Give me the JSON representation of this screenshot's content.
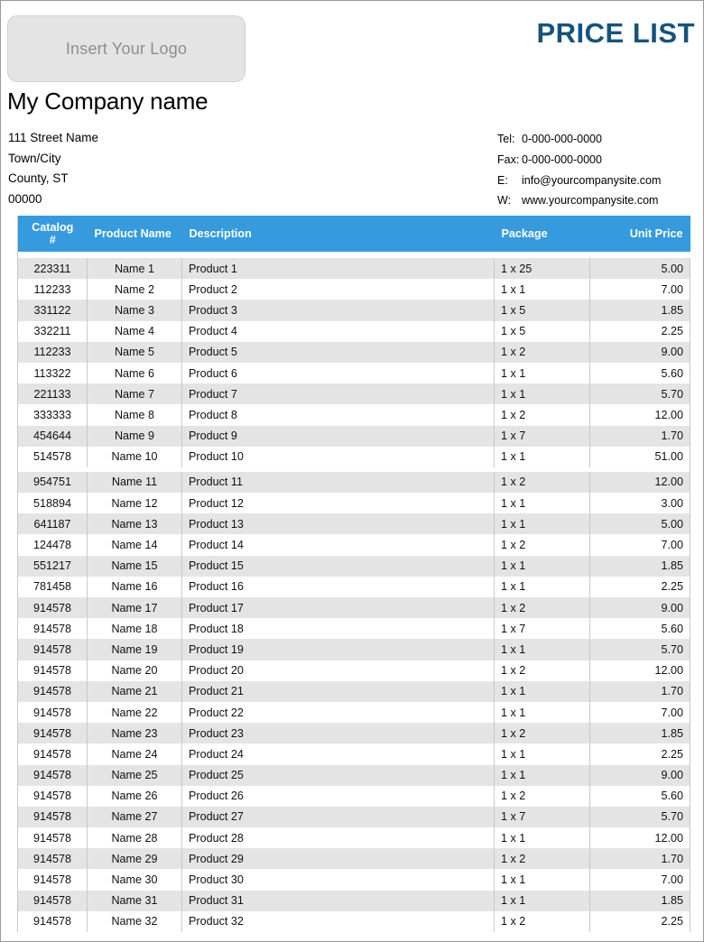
{
  "document": {
    "title": "PRICE LIST",
    "logo_placeholder": "Insert Your Logo",
    "company_name": "My Company name"
  },
  "address": {
    "line1": "111 Street Name",
    "line2": "Town/City",
    "line3": "County, ST",
    "line4": "00000"
  },
  "contact": {
    "tel_label": "Tel:",
    "tel_value": "0-000-000-0000",
    "fax_label": "Fax:",
    "fax_value": "0-000-000-0000",
    "email_label": "E:",
    "email_value": "info@yourcompanysite.com",
    "web_label": "W:",
    "web_value": "www.yourcompanysite.com"
  },
  "colors": {
    "table_header_blue": "#359ade",
    "title_navy": "#15537f",
    "row_shade": "#e4e4e4",
    "logo_fill": "#e4e4e4",
    "border_gray": "#c9c9c9"
  },
  "table": {
    "headers": {
      "catalog_line1": "Catalog",
      "catalog_line2": "#",
      "product_name": "Product Name",
      "description": "Description",
      "package": "Package",
      "unit_price": "Unit Price"
    },
    "rows": [
      {
        "catalog": "223311",
        "name": "Name 1",
        "description": "Product 1",
        "package": "1 x 25",
        "price": "5.00"
      },
      {
        "catalog": "112233",
        "name": "Name 2",
        "description": "Product 2",
        "package": "1 x 1",
        "price": "7.00"
      },
      {
        "catalog": "331122",
        "name": "Name 3",
        "description": "Product 3",
        "package": "1 x 5",
        "price": "1.85"
      },
      {
        "catalog": "332211",
        "name": "Name 4",
        "description": "Product 4",
        "package": "1 x 5",
        "price": "2.25"
      },
      {
        "catalog": "112233",
        "name": "Name 5",
        "description": "Product 5",
        "package": "1 x 2",
        "price": "9.00"
      },
      {
        "catalog": "113322",
        "name": "Name 6",
        "description": "Product 6",
        "package": "1 x 1",
        "price": "5.60"
      },
      {
        "catalog": "221133",
        "name": "Name 7",
        "description": "Product 7",
        "package": "1 x 1",
        "price": "5.70"
      },
      {
        "catalog": "333333",
        "name": "Name 8",
        "description": "Product 8",
        "package": "1 x 2",
        "price": "12.00"
      },
      {
        "catalog": "454644",
        "name": "Name 9",
        "description": "Product 9",
        "package": "1 x 7",
        "price": "1.70"
      },
      {
        "catalog": "514578",
        "name": "Name 10",
        "description": "Product 10",
        "package": "1 x 1",
        "price": "51.00"
      },
      {
        "catalog": "954751",
        "name": "Name 11",
        "description": "Product 11",
        "package": "1 x 2",
        "price": "12.00"
      },
      {
        "catalog": "518894",
        "name": "Name 12",
        "description": "Product 12",
        "package": "1 x 1",
        "price": "3.00"
      },
      {
        "catalog": "641187",
        "name": "Name 13",
        "description": "Product 13",
        "package": "1 x 1",
        "price": "5.00"
      },
      {
        "catalog": "124478",
        "name": "Name 14",
        "description": "Product 14",
        "package": "1 x 2",
        "price": "7.00"
      },
      {
        "catalog": "551217",
        "name": "Name 15",
        "description": "Product 15",
        "package": "1 x 1",
        "price": "1.85"
      },
      {
        "catalog": "781458",
        "name": "Name 16",
        "description": "Product 16",
        "package": "1 x 1",
        "price": "2.25"
      },
      {
        "catalog": "914578",
        "name": "Name 17",
        "description": "Product 17",
        "package": "1 x 2",
        "price": "9.00"
      },
      {
        "catalog": "914578",
        "name": "Name 18",
        "description": "Product 18",
        "package": "1 x 7",
        "price": "5.60"
      },
      {
        "catalog": "914578",
        "name": "Name 19",
        "description": "Product 19",
        "package": "1 x 1",
        "price": "5.70"
      },
      {
        "catalog": "914578",
        "name": "Name 20",
        "description": "Product 20",
        "package": "1 x 2",
        "price": "12.00"
      },
      {
        "catalog": "914578",
        "name": "Name 21",
        "description": "Product 21",
        "package": "1 x 1",
        "price": "1.70"
      },
      {
        "catalog": "914578",
        "name": "Name 22",
        "description": "Product 22",
        "package": "1 x 1",
        "price": "7.00"
      },
      {
        "catalog": "914578",
        "name": "Name 23",
        "description": "Product 23",
        "package": "1 x 2",
        "price": "1.85"
      },
      {
        "catalog": "914578",
        "name": "Name 24",
        "description": "Product 24",
        "package": "1 x 1",
        "price": "2.25"
      },
      {
        "catalog": "914578",
        "name": "Name 25",
        "description": "Product 25",
        "package": "1 x 1",
        "price": "9.00"
      },
      {
        "catalog": "914578",
        "name": "Name 26",
        "description": "Product 26",
        "package": "1 x 2",
        "price": "5.60"
      },
      {
        "catalog": "914578",
        "name": "Name 27",
        "description": "Product 27",
        "package": "1 x 7",
        "price": "5.70"
      },
      {
        "catalog": "914578",
        "name": "Name 28",
        "description": "Product 28",
        "package": "1 x 1",
        "price": "12.00"
      },
      {
        "catalog": "914578",
        "name": "Name 29",
        "description": "Product 29",
        "package": "1 x 2",
        "price": "1.70"
      },
      {
        "catalog": "914578",
        "name": "Name 30",
        "description": "Product 30",
        "package": "1 x 1",
        "price": "7.00"
      },
      {
        "catalog": "914578",
        "name": "Name 31",
        "description": "Product 31",
        "package": "1 x 1",
        "price": "1.85"
      },
      {
        "catalog": "914578",
        "name": "Name 32",
        "description": "Product 32",
        "package": "1 x 2",
        "price": "2.25"
      }
    ],
    "spacer_after_row_index": 9
  }
}
